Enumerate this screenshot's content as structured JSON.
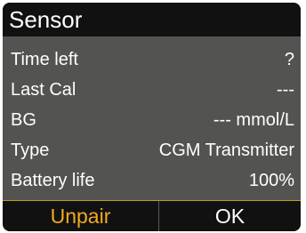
{
  "screen": {
    "title": "Sensor"
  },
  "rows": [
    {
      "label": "Time left",
      "value": "?"
    },
    {
      "label": "Last Cal",
      "value": "---"
    },
    {
      "label": "BG",
      "value": "--- mmol/L"
    },
    {
      "label": "Type",
      "value": "CGM Transmitter"
    },
    {
      "label": "Battery life",
      "value": "100%"
    }
  ],
  "softkeys": {
    "left": "Unpair",
    "right": "OK"
  },
  "colors": {
    "panel": "#535351",
    "bar": "#111111",
    "accent": "#f0aa22",
    "text": "#ffffff"
  }
}
